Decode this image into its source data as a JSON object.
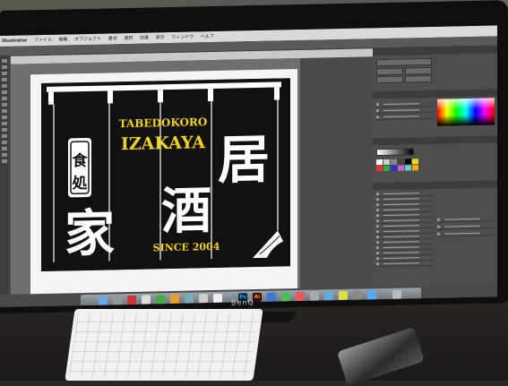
{
  "menubar": {
    "app_name": "Illustrator",
    "items": [
      "ファイル",
      "編集",
      "オブジェクト",
      "書式",
      "選択",
      "効果",
      "表示",
      "ウィンドウ",
      "ヘルプ"
    ]
  },
  "noren": {
    "top_text": "TABEDOKORO",
    "izakaya": "IZAKAYA",
    "since": "SINCE 2004",
    "label_chars": [
      "食",
      "処"
    ],
    "big_char_left": "家",
    "big_char_center": "酒",
    "big_char_right": "居",
    "accent_color": "#f1d21c"
  },
  "monitor": {
    "brand": "BenQ"
  },
  "dock": {
    "icons": [
      "finder-icon",
      "photoshop-icon",
      "illustrator-icon",
      "browser-icon",
      "trash-icon"
    ],
    "visible_labels": {
      "photoshop": "Ps",
      "illustrator": "Ai"
    }
  }
}
